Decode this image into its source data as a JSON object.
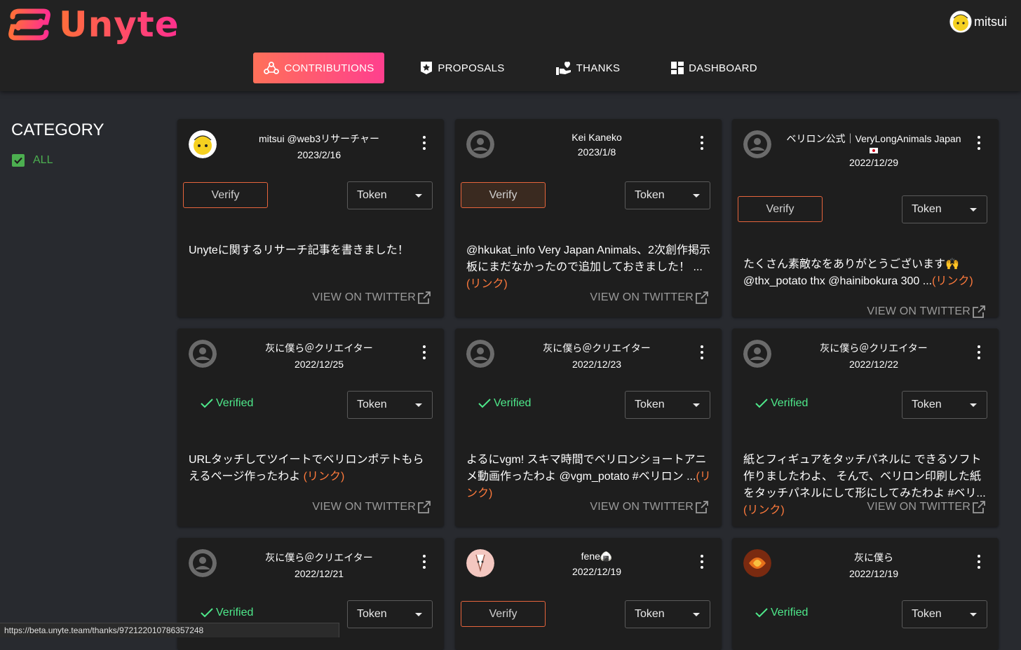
{
  "app": {
    "logo_text": "Unyte"
  },
  "user": {
    "name": "mitsui"
  },
  "nav": {
    "tabs": [
      {
        "label": "CONTRIBUTIONS",
        "active": true,
        "icon": "contributions-icon"
      },
      {
        "label": "PROPOSALS",
        "active": false,
        "icon": "proposals-icon"
      },
      {
        "label": "THANKS",
        "active": false,
        "icon": "thanks-icon"
      },
      {
        "label": "DASHBOARD",
        "active": false,
        "icon": "dashboard-icon"
      }
    ]
  },
  "sidebar": {
    "title": "CATEGORY",
    "items": [
      {
        "label": "ALL",
        "checked": true
      }
    ]
  },
  "common": {
    "verify_label": "Verify",
    "verified_label": "Verified",
    "token_label": "Token",
    "view_label": "VIEW ON TWITTER"
  },
  "cards": [
    {
      "name": "mitsui @web3リサーチャー",
      "date": "2023/2/16",
      "status": "verify",
      "text": "Unyteに関するリサーチ記事を書きました！",
      "link": ""
    },
    {
      "name": "Kei Kaneko",
      "date": "2023/1/8",
      "status": "verify",
      "text": "@hkukat_info Very Japan Animals、2次創作掲示板にまだなかったので追加しておきました！ ...",
      "link": "(リンク)"
    },
    {
      "name": "ベリロン公式｜VeryLongAnimals Japan",
      "date": "2022/12/29",
      "status": "verify",
      "text": "たくさん素敵なをありがとうございます🙌 @thx_potato thx @hainibokura 300 ...",
      "link": "(リンク)"
    },
    {
      "name": "灰に僕ら＠クリエイター",
      "date": "2022/12/25",
      "status": "verified",
      "text": "URLタッチしてツイートでベリロンポテトもらえるページ作ったわよ ",
      "link": "(リンク)"
    },
    {
      "name": "灰に僕ら＠クリエイター",
      "date": "2022/12/23",
      "status": "verified",
      "text": "よるにvgm! スキマ時間でベリロンショートアニメ動画作ったわよ @vgm_potato #ベリロン ...",
      "link": "(リンク)"
    },
    {
      "name": "灰に僕ら＠クリエイター",
      "date": "2022/12/22",
      "status": "verified",
      "text": "紙とフィギュアをタッチパネルに できるソフト作りましたわよ、 そんで、ベリロン印刷した紙をタッチパネルにして形にしてみたわよ #ベリ...",
      "link": "(リンク)"
    },
    {
      "name": "灰に僕ら＠クリエイター",
      "date": "2022/12/21",
      "status": "verified",
      "text": "",
      "link": ""
    },
    {
      "name": "fene🍙",
      "date": "2022/12/19",
      "status": "verify",
      "text": "",
      "link": ""
    },
    {
      "name": "灰に僕ら",
      "date": "2022/12/19",
      "status": "verified",
      "text": "",
      "link": ""
    }
  ],
  "statusbar": {
    "url": "https://beta.unyte.team/thanks/972122010786357248"
  },
  "colors": {
    "accent": "#ff4f7b",
    "verified": "#4ee88a",
    "verify_border": "#e6643c",
    "link": "#ff7a3c"
  }
}
